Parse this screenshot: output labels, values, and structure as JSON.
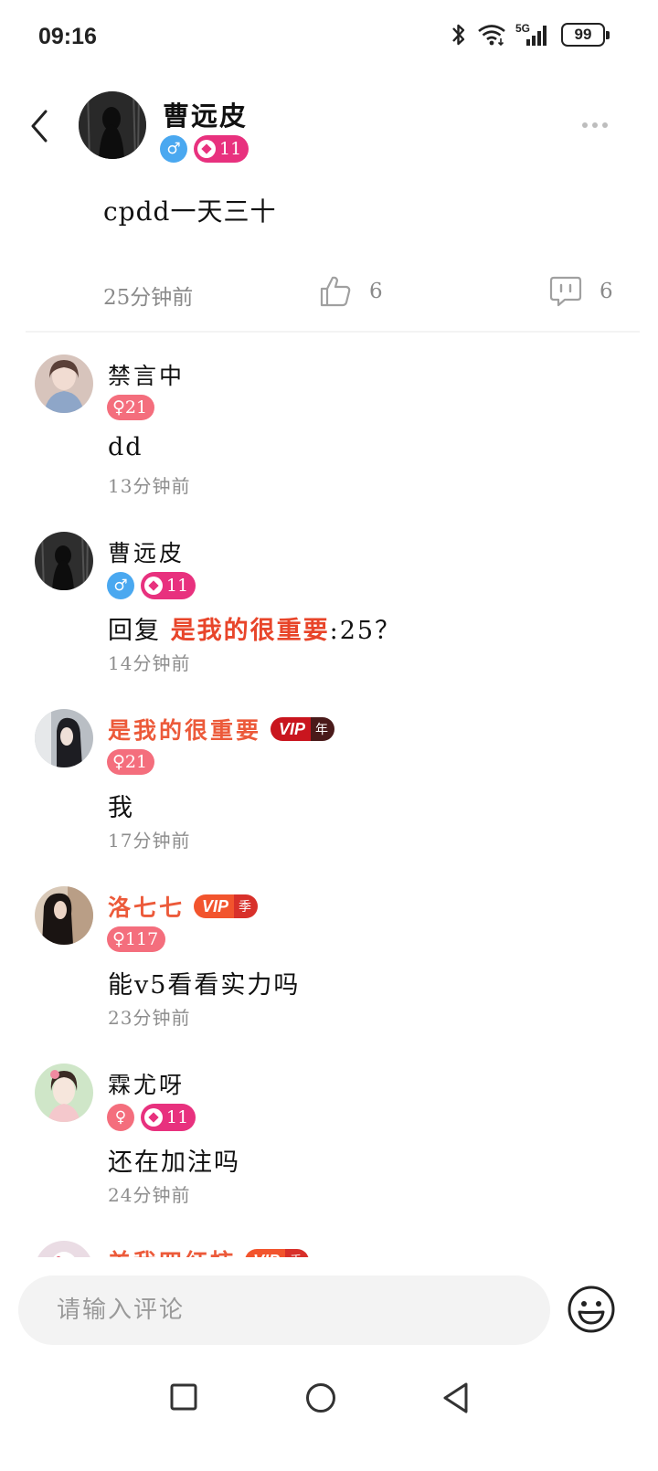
{
  "status_bar": {
    "time": "09:16",
    "network_label": "5G",
    "battery": "99"
  },
  "post": {
    "author": "曹远皮",
    "gender_symbol": "♂",
    "level": "11",
    "text": "cpdd一天三十",
    "time": "25分钟前",
    "likes": "6",
    "comments": "6"
  },
  "comments": [
    {
      "name": "禁言中",
      "name_style": "normal",
      "vip": null,
      "badge_type": "female-age",
      "badge_text": "♀21",
      "text": "dd",
      "time": "13分钟前",
      "avatar_color": "#c9a9a0"
    },
    {
      "name": "曹远皮",
      "name_style": "normal",
      "vip": null,
      "badge_type": "male-level",
      "gender_symbol": "♂",
      "level": "11",
      "reply_prefix": "回复 ",
      "reply_to": "是我的很重要",
      "reply_text": ":25？",
      "time": "14分钟前",
      "avatar_color": "#2a2a2a"
    },
    {
      "name": "是我的很重要",
      "name_style": "vip",
      "vip": {
        "label": "VIP",
        "kind": "年",
        "style": "year"
      },
      "badge_type": "female-age",
      "badge_text": "♀21",
      "text": "我",
      "time": "17分钟前",
      "avatar_color": "#9aa0a8"
    },
    {
      "name": "洛七七",
      "name_style": "vip",
      "vip": {
        "label": "VIP",
        "kind": "季",
        "style": "season"
      },
      "badge_type": "female-age",
      "badge_text": "♀117",
      "text": "能v5看看实力吗",
      "time": "23分钟前",
      "avatar_color": "#6b5a50"
    },
    {
      "name": "霖尤呀",
      "name_style": "normal",
      "vip": null,
      "badge_type": "female-level",
      "gender_symbol": "♀",
      "level": "11",
      "text": "还在加注吗",
      "time": "24分钟前",
      "avatar_color": "#b8d8b0"
    },
    {
      "name": "羊我四红柿",
      "name_style": "vip",
      "vip": {
        "label": "VIP",
        "kind": "季",
        "style": "season"
      },
      "time": "",
      "avatar_color": "#e8d8e0"
    }
  ],
  "input": {
    "placeholder": "请输入评论"
  },
  "icons": {
    "back": "back-chevron-icon",
    "more": "more-dots-icon",
    "like": "thumbs-up-icon",
    "comment": "comment-bubble-icon",
    "emoji": "smiley-emoji-icon"
  },
  "colors": {
    "vip_name": "#ec5a3a",
    "reply_name": "#e8452a",
    "male": "#4aa8f0",
    "female": "#f46e7d",
    "level": "#e8317e"
  }
}
